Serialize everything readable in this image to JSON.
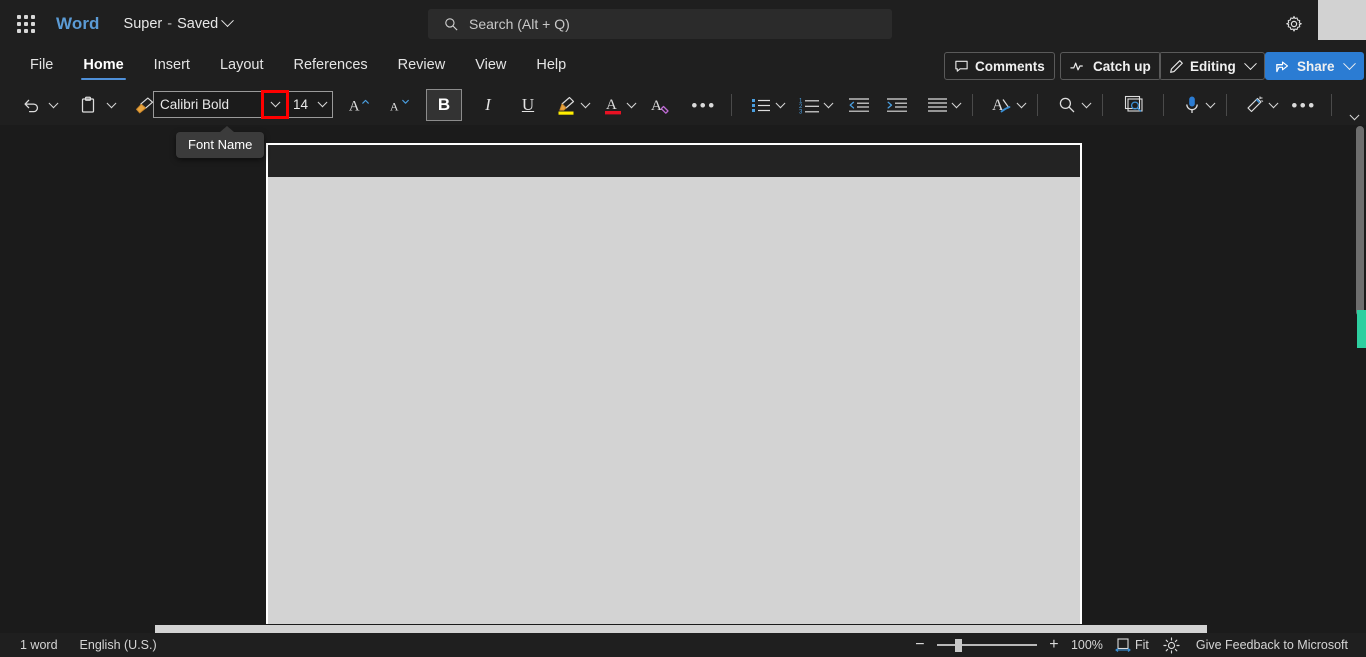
{
  "titlebar": {
    "app_launcher": "app-launcher",
    "app_name": "Word",
    "doc_name": "Super",
    "doc_separator": "-",
    "doc_state": "Saved",
    "settings_icon": "gear-icon"
  },
  "search": {
    "icon": "search-icon",
    "placeholder": "Search (Alt + Q)"
  },
  "ribbon_tabs": [
    {
      "label": "File",
      "active": false
    },
    {
      "label": "Home",
      "active": true
    },
    {
      "label": "Insert",
      "active": false
    },
    {
      "label": "Layout",
      "active": false
    },
    {
      "label": "References",
      "active": false
    },
    {
      "label": "Review",
      "active": false
    },
    {
      "label": "View",
      "active": false
    },
    {
      "label": "Help",
      "active": false
    }
  ],
  "right_buttons": {
    "comments": "Comments",
    "catch_up": "Catch up",
    "editing": "Editing",
    "share": "Share"
  },
  "toolbar": {
    "undo": "undo-icon",
    "paste": "paste-icon",
    "format_painter": "format-painter-icon",
    "font_name": "Calibri Bold",
    "font_size": "14",
    "grow_font": "grow-font-icon",
    "shrink_font": "shrink-font-icon",
    "bold": "B",
    "italic": "I",
    "underline": "U",
    "highlight": "text-highlight-icon",
    "font_color": "font-color-icon",
    "clear_formatting": "clear-formatting-icon",
    "more_font_options": "•••",
    "bullets": "bullet-list-icon",
    "numbering": "numbered-list-icon",
    "decrease_indent": "decrease-indent-icon",
    "increase_indent": "increase-indent-icon",
    "align": "align-icon",
    "styles": "styles-icon",
    "find": "find-icon",
    "editor": "editor-icon",
    "dictate": "dictate-icon",
    "copilot": "copilot-icon",
    "more_commands": "•••",
    "collapse_ribbon": "chevron-down-icon"
  },
  "tooltip": {
    "text": "Font Name"
  },
  "highlight": {
    "target": "font-name-dropdown-chevron",
    "color": "#ff0000"
  },
  "statusbar": {
    "word_count": "1 word",
    "language": "English (U.S.)",
    "zoom_out": "−",
    "zoom_in": "+",
    "zoom_level": "100%",
    "fit": "Fit",
    "focus": "focus-icon",
    "feedback": "Give Feedback to Microsoft"
  },
  "colors": {
    "app_blue": "#5b9bd5",
    "tab_underline": "#4f90d9",
    "share_blue": "#2b7cd3",
    "highlight_red": "#ff0000",
    "scroll_accent": "#2ecfa0",
    "page_bg": "#d3d3d3"
  }
}
